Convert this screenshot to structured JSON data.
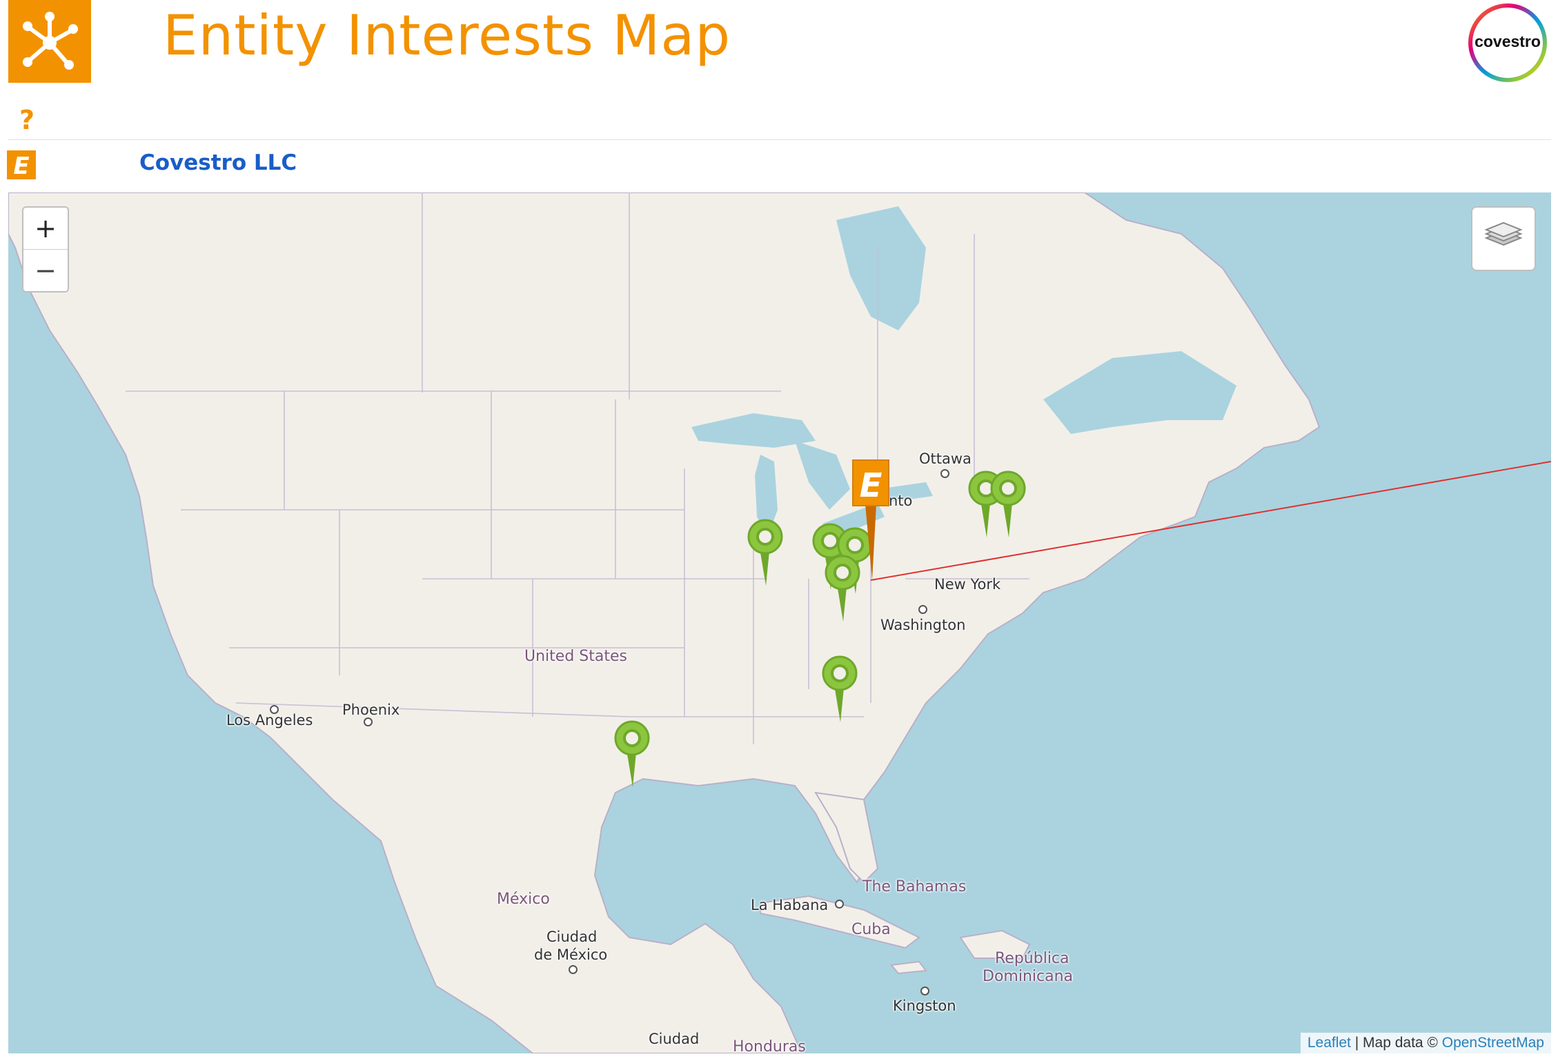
{
  "header": {
    "title": "Entity Interests Map",
    "logo_icon": "network-hub-icon",
    "brand_logo_text": "covestro",
    "help_symbol": "?",
    "accent_color": "#f39200"
  },
  "entity": {
    "icon_letter": "E",
    "name": "Covestro LLC",
    "name_color": "#1a5dc7"
  },
  "map": {
    "zoom_in": "+",
    "zoom_out": "−",
    "layers_icon": "layers-icon",
    "attribution": {
      "leaflet": "Leaflet",
      "separator": " | Map data © ",
      "osm": "OpenStreetMap"
    },
    "labels": {
      "ottawa": "Ottawa",
      "toronto": "nto",
      "new_york": "New York",
      "washington": "Washington",
      "united_states": "United States",
      "phoenix": "Phoenix",
      "los_angeles": "Los Angeles",
      "mexico": "México",
      "ciudad_de_mexico_1": "Ciudad",
      "ciudad_de_mexico_2": "de México",
      "la_habana": "La Habana",
      "the_bahamas": "The Bahamas",
      "cuba": "Cuba",
      "republica_1": "República",
      "republica_2": "Dominicana",
      "kingston": "Kingston",
      "ciudad_guatemala": "Ciudad",
      "honduras": "Honduras"
    },
    "pin_colors": {
      "interest": "#8cc63f",
      "entity": "#f39200",
      "link_line": "#e03030"
    }
  }
}
